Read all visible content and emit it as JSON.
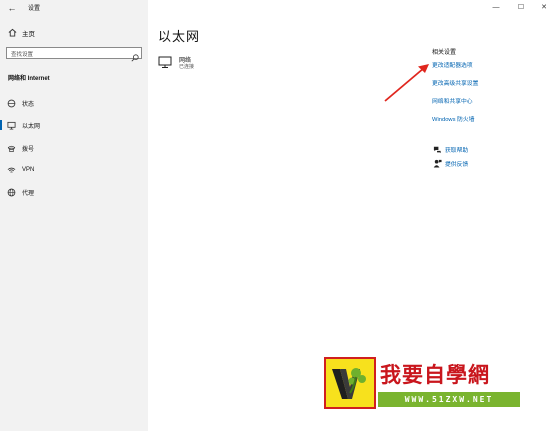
{
  "window": {
    "title": "设置",
    "minimize_glyph": "—",
    "maximize_glyph": "☐",
    "close_glyph": "✕"
  },
  "sidebar": {
    "home_label": "主页",
    "search_placeholder": "查找设置",
    "section_title": "网络和 Internet",
    "items": [
      {
        "label": "状态",
        "icon": "status-icon",
        "active": false
      },
      {
        "label": "以太网",
        "icon": "ethernet-icon",
        "active": true
      },
      {
        "label": "拨号",
        "icon": "dialup-icon",
        "active": false
      },
      {
        "label": "VPN",
        "icon": "vpn-icon",
        "active": false
      },
      {
        "label": "代理",
        "icon": "proxy-icon",
        "active": false
      }
    ]
  },
  "main": {
    "title": "以太网",
    "network": {
      "name": "网络",
      "status": "已连接",
      "icon": "monitor-network-icon"
    }
  },
  "related": {
    "title": "相关设置",
    "links": [
      "更改适配器选项",
      "更改高级共享设置",
      "网络和共享中心",
      "Windows 防火墙"
    ],
    "help": [
      {
        "label": "获取帮助",
        "icon": "help-chat-icon"
      },
      {
        "label": "提供反馈",
        "icon": "feedback-person-icon"
      }
    ]
  },
  "watermark": {
    "text_cn": "我要自學網",
    "url": "WWW.51ZXW.NET"
  },
  "colors": {
    "accent": "#0063b1",
    "annotation_arrow": "#e0261e"
  }
}
